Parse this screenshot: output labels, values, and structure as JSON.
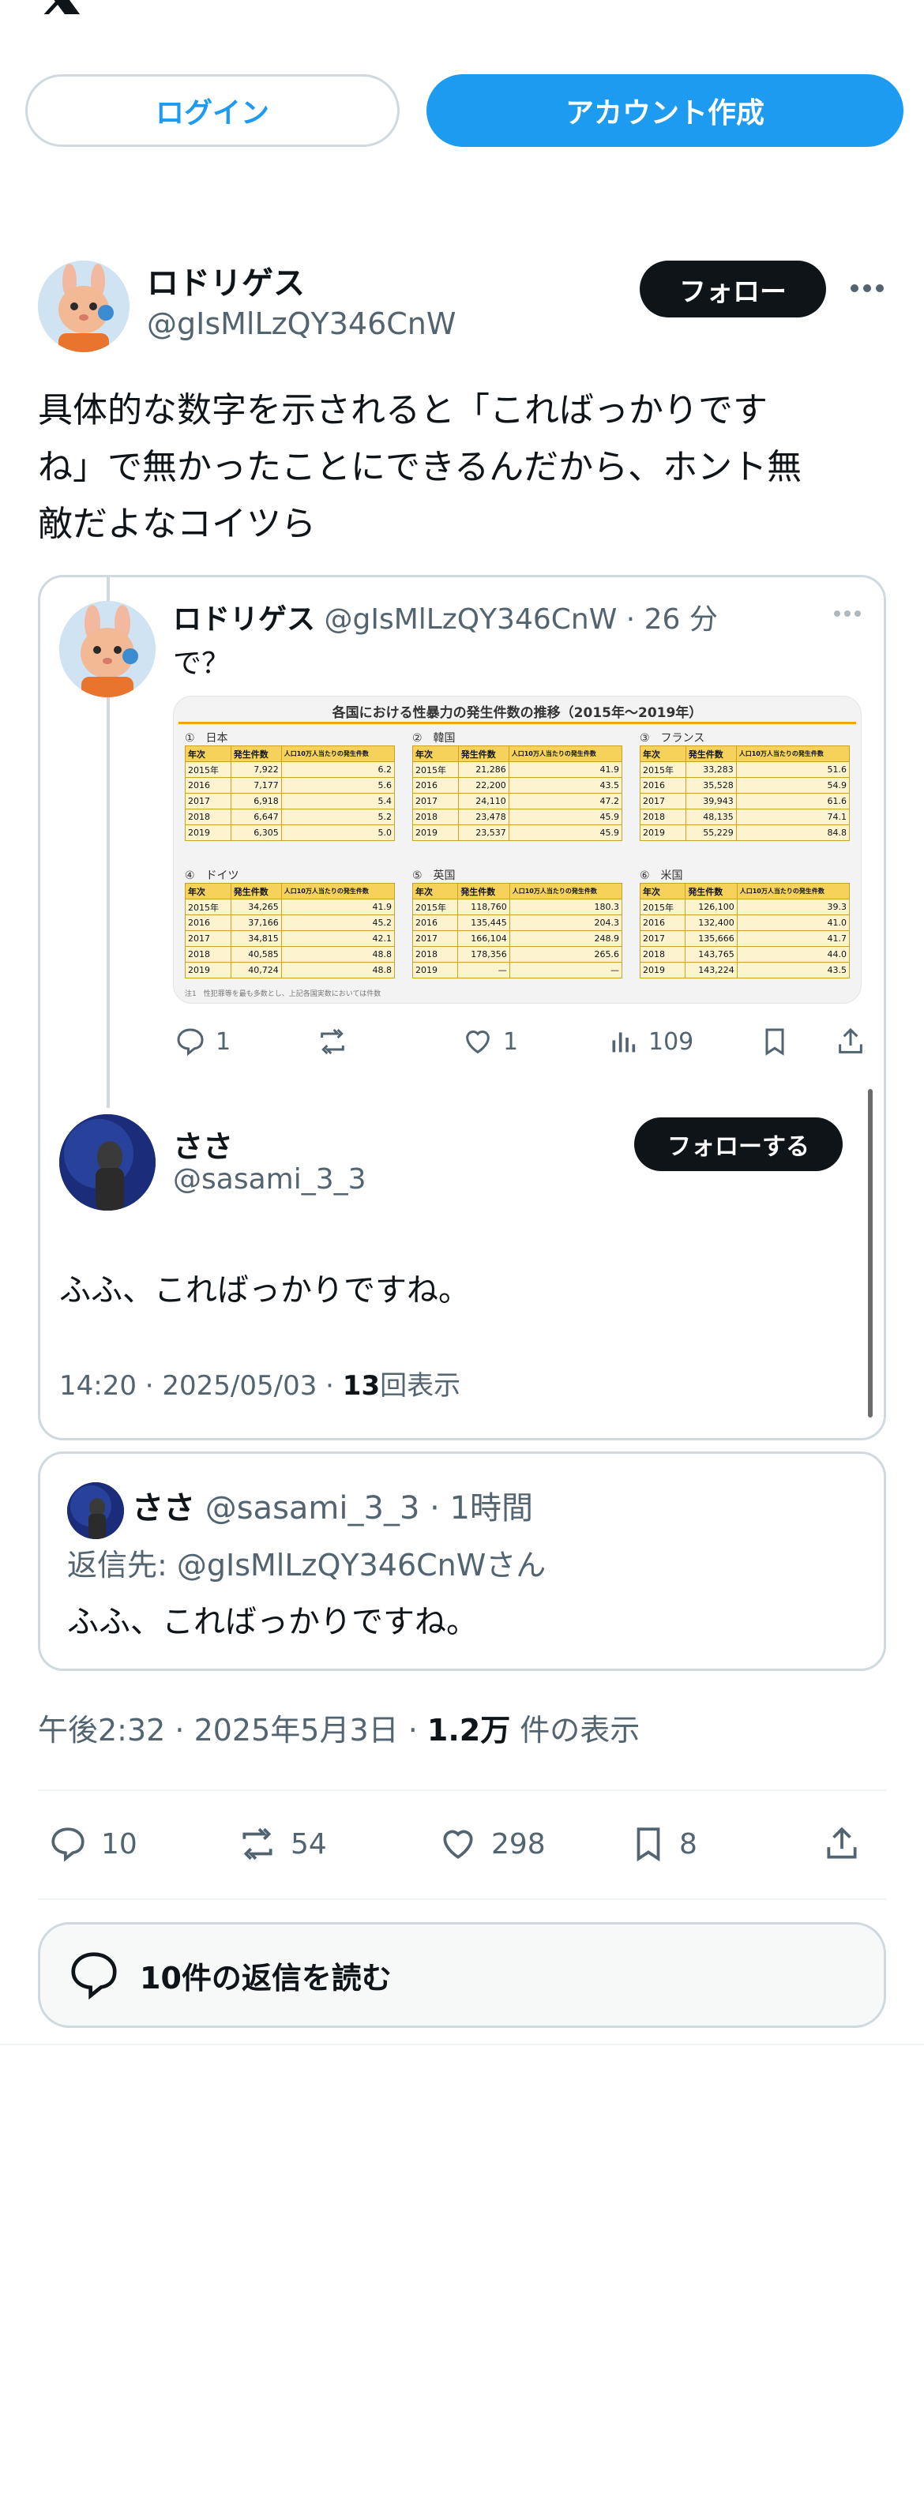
{
  "header": {
    "logo": "x-logo",
    "login_label": "ログイン",
    "signup_label": "アカウント作成"
  },
  "tweet": {
    "author_name": "ロドリゲス",
    "author_handle": "@gIsMlLzQY346CnW",
    "follow_label": "フォロー",
    "text_line1": "具体的な数字を示されると「こればっかりです",
    "text_line2": "ね」で無かったことにできるんだから、ホント無",
    "text_line3": "敵だよなコイツら",
    "meta_time": "午後2:32 · 2025年5月3日 · ",
    "meta_views": "1.2万",
    "meta_views_suffix": " 件の表示",
    "actions": {
      "replies": "10",
      "retweets": "54",
      "likes": "298",
      "bookmarks": "8"
    },
    "read_replies_label": "10件の返信を読む"
  },
  "embedded_thread": {
    "parent": {
      "author_name": "ロドリゲス",
      "author_handle": "@gIsMlLzQY346CnW",
      "time": "· 26 分",
      "text": "で？",
      "actions": {
        "replies": "1",
        "likes": "1",
        "views": "109"
      }
    },
    "reply": {
      "author_name": "ささ",
      "author_handle": "@sasami_3_3",
      "follow_label": "フォローする",
      "text": "ふふ、こればっかりですね。",
      "meta_time": "14:20 · 2025/05/03 · ",
      "meta_views": "13",
      "meta_views_suffix": "回表示"
    }
  },
  "quoted_tweet": {
    "author_name": "ささ",
    "author_handle": "@sasami_3_3",
    "time": "· 1時間",
    "reply_to": "返信先: @gIsMlLzQY346CnWさん",
    "text": "ふふ、こればっかりですね。"
  },
  "chart_data": {
    "type": "table",
    "title": "各国における性暴力の発生件数の推移（2015年〜2019年）",
    "columns": [
      "年次",
      "発生件数",
      "人口10万人当たりの発生件数"
    ],
    "tables": [
      {
        "label": "①　日本",
        "rows": [
          [
            "2015年",
            "7,922",
            "6.2"
          ],
          [
            "2016",
            "7,177",
            "5.6"
          ],
          [
            "2017",
            "6,918",
            "5.4"
          ],
          [
            "2018",
            "6,647",
            "5.2"
          ],
          [
            "2019",
            "6,305",
            "5.0"
          ]
        ]
      },
      {
        "label": "②　韓国",
        "rows": [
          [
            "2015年",
            "21,286",
            "41.9"
          ],
          [
            "2016",
            "22,200",
            "43.5"
          ],
          [
            "2017",
            "24,110",
            "47.2"
          ],
          [
            "2018",
            "23,478",
            "45.9"
          ],
          [
            "2019",
            "23,537",
            "45.9"
          ]
        ]
      },
      {
        "label": "③　フランス",
        "rows": [
          [
            "2015年",
            "33,283",
            "51.6"
          ],
          [
            "2016",
            "35,528",
            "54.9"
          ],
          [
            "2017",
            "39,943",
            "61.6"
          ],
          [
            "2018",
            "48,135",
            "74.1"
          ],
          [
            "2019",
            "55,229",
            "84.8"
          ]
        ]
      },
      {
        "label": "④　ドイツ",
        "rows": [
          [
            "2015年",
            "34,265",
            "41.9"
          ],
          [
            "2016",
            "37,166",
            "45.2"
          ],
          [
            "2017",
            "34,815",
            "42.1"
          ],
          [
            "2018",
            "40,585",
            "48.8"
          ],
          [
            "2019",
            "40,724",
            "48.8"
          ]
        ]
      },
      {
        "label": "⑤　英国",
        "rows": [
          [
            "2015年",
            "118,760",
            "180.3"
          ],
          [
            "2016",
            "135,445",
            "204.3"
          ],
          [
            "2017",
            "166,104",
            "248.9"
          ],
          [
            "2018",
            "178,356",
            "265.6"
          ],
          [
            "2019",
            "—",
            "—"
          ]
        ]
      },
      {
        "label": "⑥　米国",
        "rows": [
          [
            "2015年",
            "126,100",
            "39.3"
          ],
          [
            "2016",
            "132,400",
            "41.0"
          ],
          [
            "2017",
            "135,666",
            "41.7"
          ],
          [
            "2018",
            "143,765",
            "44.0"
          ],
          [
            "2019",
            "143,224",
            "43.5"
          ]
        ]
      }
    ],
    "footnote": "注1　性犯罪等を最も多数とし、上記各国実数においては件数"
  }
}
